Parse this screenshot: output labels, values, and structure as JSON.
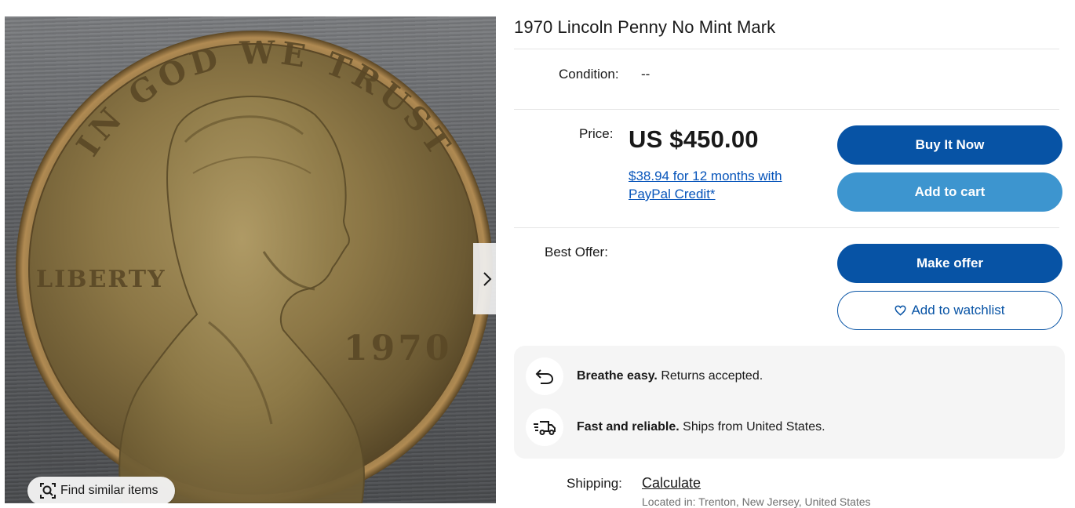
{
  "listing": {
    "title": "1970 Lincoln Penny No Mint Mark"
  },
  "gallery": {
    "find_similar_label": "Find similar items",
    "coin_text": {
      "motto": "IN GOD WE TRUST",
      "liberty": "LIBERTY",
      "year": "1970"
    }
  },
  "condition": {
    "label": "Condition:",
    "value": "--"
  },
  "price": {
    "label": "Price:",
    "value": "US $450.00",
    "financing_link": "$38.94 for 12 months with PayPal Credit*"
  },
  "buttons": {
    "buy_now": "Buy It Now",
    "add_to_cart": "Add to cart",
    "make_offer": "Make offer",
    "watchlist": "Add to watchlist"
  },
  "best_offer": {
    "label": "Best Offer:"
  },
  "highlights": [
    {
      "bold": "Breathe easy.",
      "text": " Returns accepted.",
      "icon": "return-arrow-icon"
    },
    {
      "bold": "Fast and reliable.",
      "text": " Ships from United States.",
      "icon": "fast-truck-icon"
    }
  ],
  "shipping": {
    "label": "Shipping:",
    "link": "Calculate",
    "location": "Located in: Trenton, New Jersey, United States"
  },
  "colors": {
    "primary_button": "#0753a5",
    "secondary_button": "#3d95cf",
    "link": "#0654ba",
    "panel_bg": "#f5f5f5"
  }
}
